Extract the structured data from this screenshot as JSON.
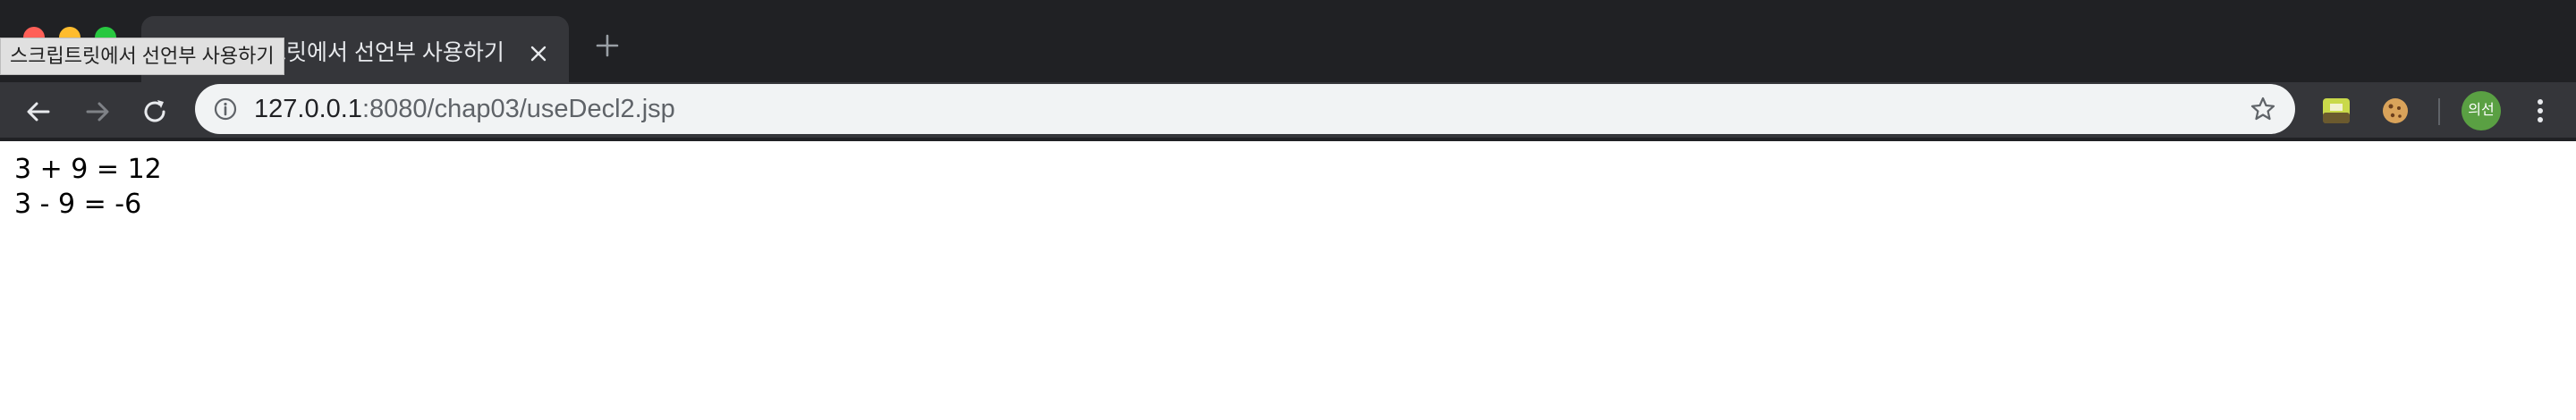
{
  "window": {
    "traffic_lights": {
      "close": "#ff5f57",
      "minimize": "#febc2e",
      "zoom": "#28c840"
    }
  },
  "tab": {
    "title": "스크립트릿에서 선언부 사용하기",
    "favicon": "page-favicon-icon",
    "close_icon": "close-icon"
  },
  "tooltip": {
    "text": "스크립트릿에서 선언부 사용하기"
  },
  "new_tab_icon": "plus-icon",
  "toolbar": {
    "back_icon": "arrow-left-icon",
    "forward_icon": "arrow-right-icon",
    "reload_icon": "reload-icon",
    "site_info_icon": "info-icon",
    "url_host": "127.0.0.1",
    "url_rest": ":8080/chap03/useDecl2.jsp",
    "bookmark_icon": "star-icon",
    "extensions": [
      "green-square-extension-icon",
      "cookie-extension-icon"
    ],
    "profile_initials": "의선",
    "profile_color": "#5aa043",
    "menu_icon": "kebab-menu-icon"
  },
  "page": {
    "lines": [
      "3 + 9 = 12",
      "3 - 9 = -6"
    ]
  }
}
